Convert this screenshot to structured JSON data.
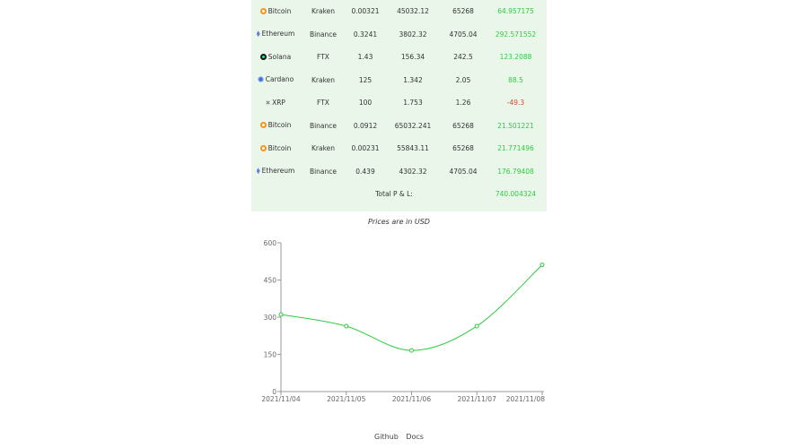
{
  "table": {
    "rows": [
      {
        "coin": "Bitcoin",
        "icon": "bitcoin-icon",
        "exchange": "Kraken",
        "amount": "0.00321",
        "buy_price": "45032.12",
        "current_price": "65268",
        "pl": "64.957175",
        "pl_sign": "pos"
      },
      {
        "coin": "Ethereum",
        "icon": "ethereum-icon",
        "exchange": "Binance",
        "amount": "0.3241",
        "buy_price": "3802.32",
        "current_price": "4705.04",
        "pl": "292.571552",
        "pl_sign": "pos"
      },
      {
        "coin": "Solana",
        "icon": "solana-icon",
        "exchange": "FTX",
        "amount": "1.43",
        "buy_price": "156.34",
        "current_price": "242.5",
        "pl": "123.2088",
        "pl_sign": "pos"
      },
      {
        "coin": "Cardano",
        "icon": "cardano-icon",
        "exchange": "Kraken",
        "amount": "125",
        "buy_price": "1.342",
        "current_price": "2.05",
        "pl": "88.5",
        "pl_sign": "pos"
      },
      {
        "coin": "XRP",
        "icon": "xrp-icon",
        "exchange": "FTX",
        "amount": "100",
        "buy_price": "1.753",
        "current_price": "1.26",
        "pl": "-49.3",
        "pl_sign": "neg"
      },
      {
        "coin": "Bitcoin",
        "icon": "bitcoin-icon",
        "exchange": "Binance",
        "amount": "0.0912",
        "buy_price": "65032.241",
        "current_price": "65268",
        "pl": "21.501221",
        "pl_sign": "pos"
      },
      {
        "coin": "Bitcoin",
        "icon": "bitcoin-icon",
        "exchange": "Kraken",
        "amount": "0.00231",
        "buy_price": "55843.11",
        "current_price": "65268",
        "pl": "21.771496",
        "pl_sign": "pos"
      },
      {
        "coin": "Ethereum",
        "icon": "ethereum-icon",
        "exchange": "Binance",
        "amount": "0.439",
        "buy_price": "4302.32",
        "current_price": "4705.04",
        "pl": "176.79408",
        "pl_sign": "pos"
      }
    ],
    "total_label": "Total P & L:",
    "total_value": "740.004324"
  },
  "caption": "Prices are in USD",
  "colors": {
    "table_background": "#eaf6ea",
    "positive": "#2ecc40",
    "negative": "#e0442c",
    "line": "#2ecc40",
    "axis": "#999999"
  },
  "chart_data": {
    "type": "line",
    "x": [
      "2021/11/04",
      "2021/11/05",
      "2021/11/06",
      "2021/11/07",
      "2021/11/08"
    ],
    "series": [
      {
        "values": [
          311,
          264,
          166,
          264,
          511
        ]
      }
    ],
    "ylim": [
      0,
      600
    ],
    "yticks": [
      "0",
      "150",
      "300",
      "450",
      "600"
    ],
    "grid": false,
    "curve": "smooth"
  },
  "footer": {
    "links": [
      "Github",
      "Docs"
    ]
  }
}
